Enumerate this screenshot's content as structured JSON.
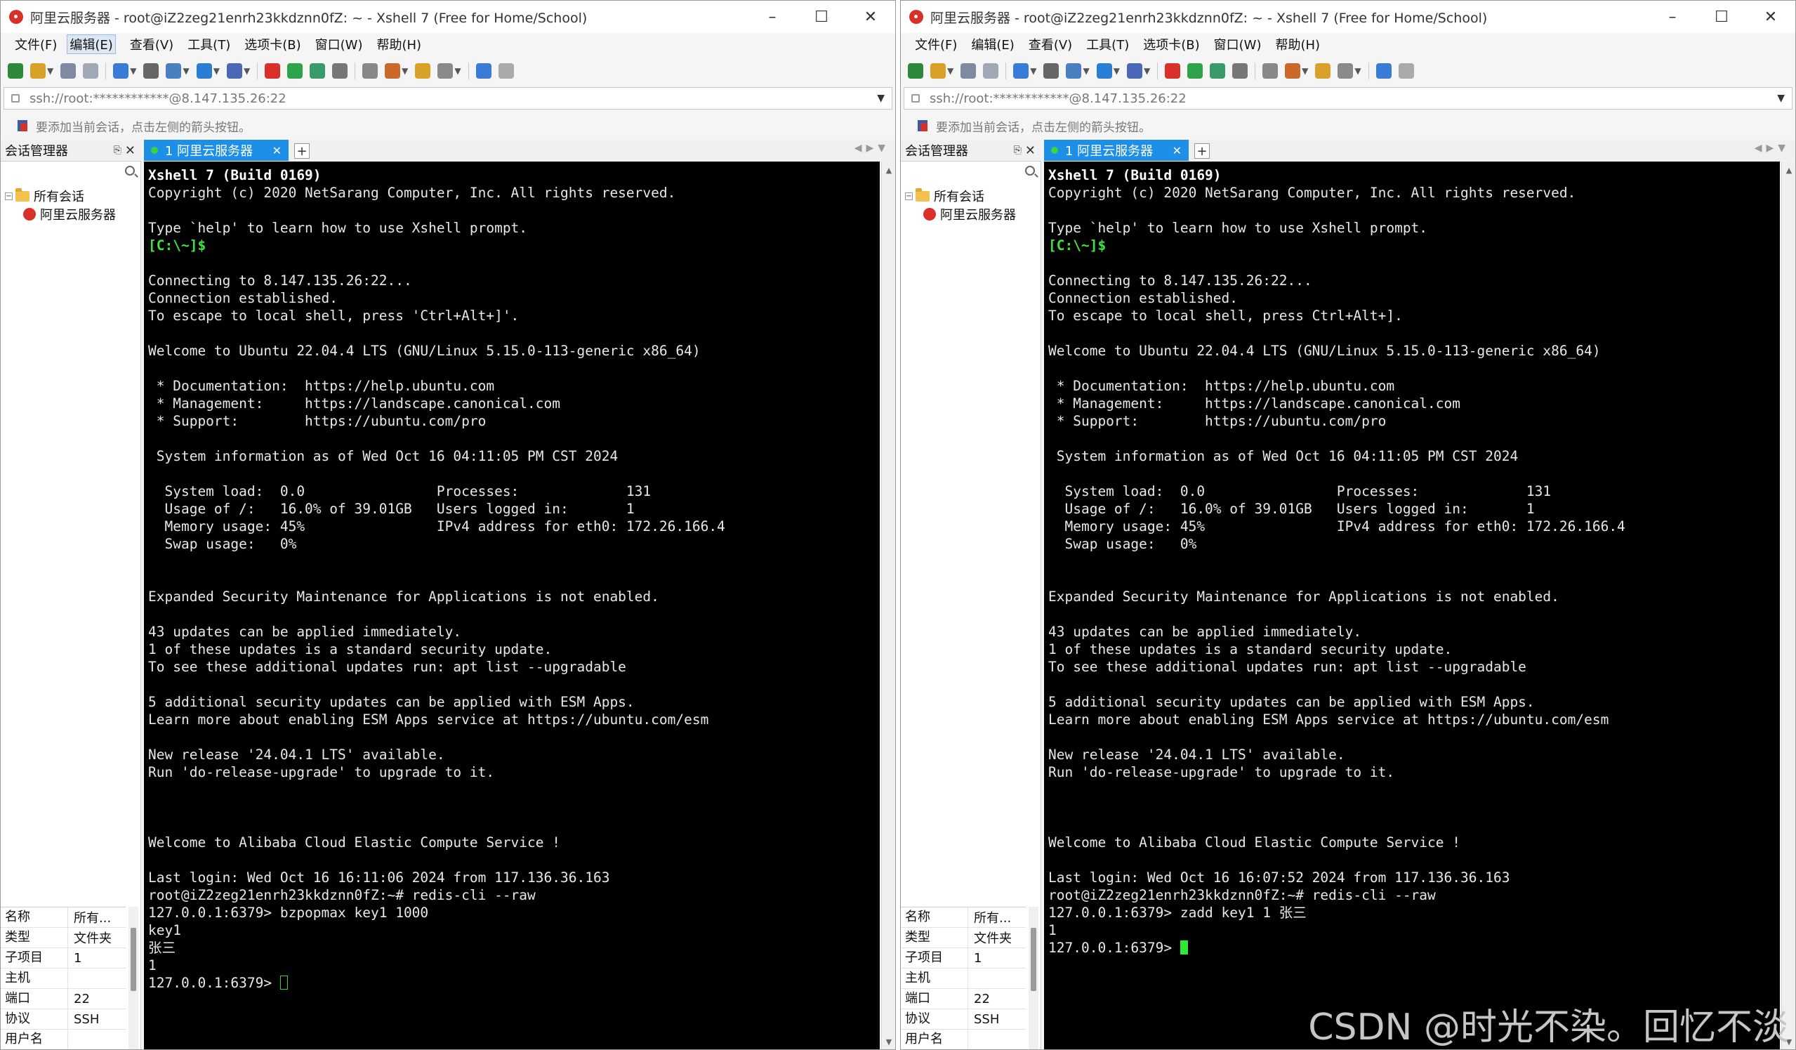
{
  "windows": [
    {
      "id": "left",
      "title": "阿里云服务器 - root@iZ2zeg21enrh23kkdznn0fZ: ~ - Xshell 7 (Free for Home/School)",
      "menu": [
        "文件(F)",
        "编辑(E)",
        "查看(V)",
        "工具(T)",
        "选项卡(B)",
        "窗口(W)",
        "帮助(H)"
      ],
      "address": "ssh://root:************@8.147.135.26:22",
      "hint": "要添加当前会话，点击左侧的箭头按钮。",
      "session_manager_title": "会话管理器",
      "tab_label": "1 阿里云服务器",
      "tree": {
        "root": "所有会话",
        "child": "阿里云服务器"
      },
      "props": [
        {
          "key": "名称",
          "value": "所有..."
        },
        {
          "key": "类型",
          "value": "文件夹"
        },
        {
          "key": "子项目",
          "value": "1"
        },
        {
          "key": "主机",
          "value": ""
        },
        {
          "key": "端口",
          "value": "22"
        },
        {
          "key": "协议",
          "value": "SSH"
        },
        {
          "key": "用户名",
          "value": ""
        }
      ],
      "terminal": {
        "lines": [
          "Xshell 7 (Build 0169)",
          "Copyright (c) 2020 NetSarang Computer, Inc. All rights reserved.",
          "",
          "Type `help' to learn how to use Xshell prompt.",
          "[C:\\~]$",
          "",
          "Connecting to 8.147.135.26:22...",
          "Connection established.",
          "To escape to local shell, press 'Ctrl+Alt+]'.",
          "",
          "Welcome to Ubuntu 22.04.4 LTS (GNU/Linux 5.15.0-113-generic x86_64)",
          "",
          " * Documentation:  https://help.ubuntu.com",
          " * Management:     https://landscape.canonical.com",
          " * Support:        https://ubuntu.com/pro",
          "",
          " System information as of Wed Oct 16 04:11:05 PM CST 2024",
          "",
          "  System load:  0.0                Processes:             131",
          "  Usage of /:   16.0% of 39.01GB   Users logged in:       1",
          "  Memory usage: 45%                IPv4 address for eth0: 172.26.166.4",
          "  Swap usage:   0%",
          "",
          "",
          "Expanded Security Maintenance for Applications is not enabled.",
          "",
          "43 updates can be applied immediately.",
          "1 of these updates is a standard security update.",
          "To see these additional updates run: apt list --upgradable",
          "",
          "5 additional security updates can be applied with ESM Apps.",
          "Learn more about enabling ESM Apps service at https://ubuntu.com/esm",
          "",
          "New release '24.04.1 LTS' available.",
          "Run 'do-release-upgrade' to upgrade to it.",
          "",
          "",
          "",
          "Welcome to Alibaba Cloud Elastic Compute Service !",
          "",
          "Last login: Wed Oct 16 16:11:06 2024 from 117.136.36.163",
          "root@iZ2zeg21enrh23kkdznn0fZ:~# redis-cli --raw",
          "127.0.0.1:6379> bzpopmax key1 1000",
          "key1",
          "张三",
          "1"
        ],
        "prompt": "127.0.0.1:6379> ",
        "cursor": "hollow"
      }
    },
    {
      "id": "right",
      "title": "阿里云服务器 - root@iZ2zeg21enrh23kkdznn0fZ: ~ - Xshell 7 (Free for Home/School)",
      "menu": [
        "文件(F)",
        "编辑(E)",
        "查看(V)",
        "工具(T)",
        "选项卡(B)",
        "窗口(W)",
        "帮助(H)"
      ],
      "address": "ssh://root:************@8.147.135.26:22",
      "hint": "要添加当前会话，点击左侧的箭头按钮。",
      "session_manager_title": "会话管理器",
      "tab_label": "1 阿里云服务器",
      "tree": {
        "root": "所有会话",
        "child": "阿里云服务器"
      },
      "props": [
        {
          "key": "名称",
          "value": "所有..."
        },
        {
          "key": "类型",
          "value": "文件夹"
        },
        {
          "key": "子项目",
          "value": "1"
        },
        {
          "key": "主机",
          "value": ""
        },
        {
          "key": "端口",
          "value": "22"
        },
        {
          "key": "协议",
          "value": "SSH"
        },
        {
          "key": "用户名",
          "value": ""
        }
      ],
      "terminal": {
        "lines": [
          "Xshell 7 (Build 0169)",
          "Copyright (c) 2020 NetSarang Computer, Inc. All rights reserved.",
          "",
          "Type `help' to learn how to use Xshell prompt.",
          "[C:\\~]$",
          "",
          "Connecting to 8.147.135.26:22...",
          "Connection established.",
          "To escape to local shell, press Ctrl+Alt+].",
          "",
          "Welcome to Ubuntu 22.04.4 LTS (GNU/Linux 5.15.0-113-generic x86_64)",
          "",
          " * Documentation:  https://help.ubuntu.com",
          " * Management:     https://landscape.canonical.com",
          " * Support:        https://ubuntu.com/pro",
          "",
          " System information as of Wed Oct 16 04:11:05 PM CST 2024",
          "",
          "  System load:  0.0                Processes:             131",
          "  Usage of /:   16.0% of 39.01GB   Users logged in:       1",
          "  Memory usage: 45%                IPv4 address for eth0: 172.26.166.4",
          "  Swap usage:   0%",
          "",
          "",
          "Expanded Security Maintenance for Applications is not enabled.",
          "",
          "43 updates can be applied immediately.",
          "1 of these updates is a standard security update.",
          "To see these additional updates run: apt list --upgradable",
          "",
          "5 additional security updates can be applied with ESM Apps.",
          "Learn more about enabling ESM Apps service at https://ubuntu.com/esm",
          "",
          "New release '24.04.1 LTS' available.",
          "Run 'do-release-upgrade' to upgrade to it.",
          "",
          "",
          "",
          "Welcome to Alibaba Cloud Elastic Compute Service !",
          "",
          "Last login: Wed Oct 16 16:07:52 2024 from 117.136.36.163",
          "root@iZ2zeg21enrh23kkdznn0fZ:~# redis-cli --raw",
          "127.0.0.1:6379> zadd key1 1 张三",
          "1"
        ],
        "prompt": "127.0.0.1:6379> ",
        "cursor": "solid"
      }
    }
  ],
  "toolbar_icons": [
    "new-session-icon",
    "open-folder-icon",
    "reconnect-icon",
    "disconnect-icon",
    "new-tab-icon",
    "find-icon",
    "layout-icon",
    "globe-icon",
    "font-icon",
    "xftp-icon",
    "xshell-green-icon",
    "fullscreen-icon",
    "lock-icon",
    "keyboard-icon",
    "script-icon",
    "transfer-icon",
    "options-icon",
    "help-icon",
    "chat-icon"
  ],
  "colors": {
    "tab_active": "#1e8fe6",
    "terminal_bg": "#000000",
    "prompt_green": "#3fe33f",
    "cursor_green": "#2fe82f"
  },
  "watermark": "CSDN @时光不染。回忆不淡"
}
